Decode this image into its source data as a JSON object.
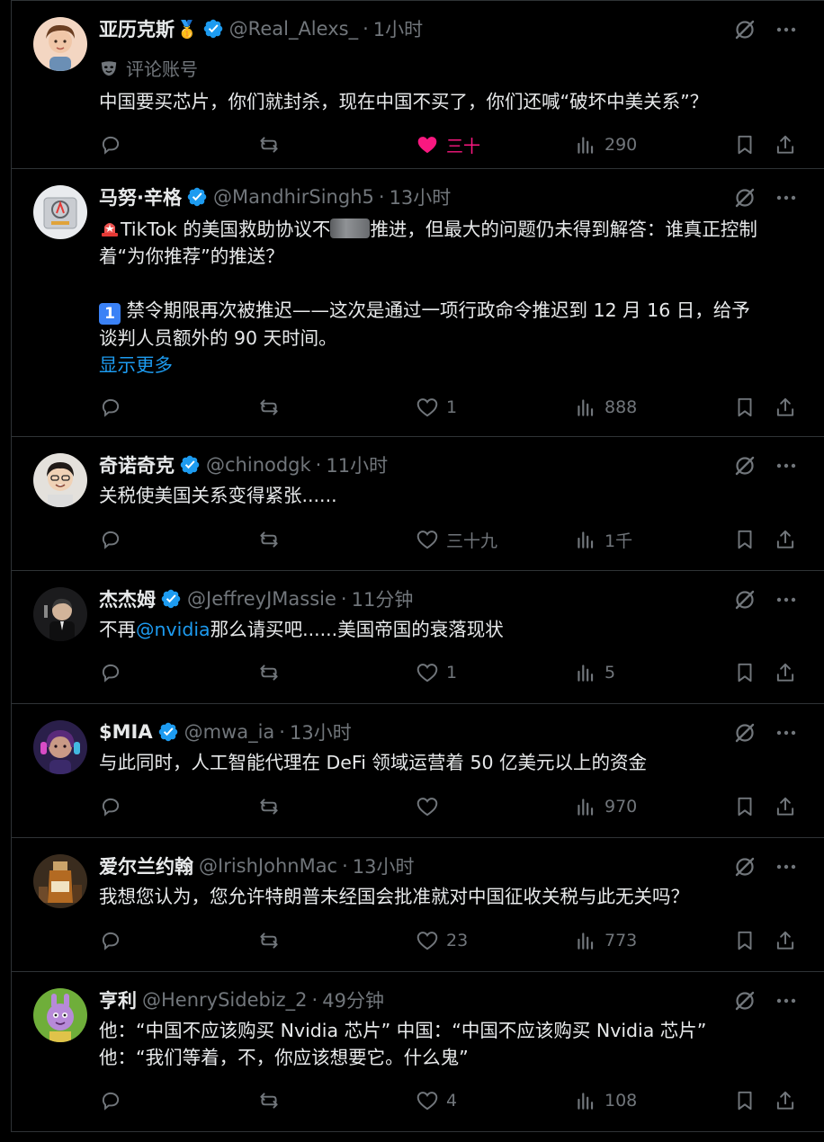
{
  "colors": {
    "background": "#000000",
    "text": "#e7e9ea",
    "muted": "#71767b",
    "link": "#1d9bf0",
    "liked": "#f91880",
    "verified": "#1d9bf0",
    "divider": "#2f3336"
  },
  "posts": [
    {
      "name": "亚历克斯",
      "name_badge": "🥇",
      "handle": "@Real_Alexs_",
      "time": "1小时",
      "sub_label": "评论账号",
      "sub_icon": "mask-icon",
      "text_lines": [
        "中国要买芯片，你们就封杀，现在中国不买了，你们还喊“破坏中美关系”？"
      ],
      "reply_count": "",
      "repost_count": "",
      "like_count": "三十",
      "liked": true,
      "view_count": "290"
    },
    {
      "name": "马努·辛格",
      "handle": "@MandhirSingh5",
      "time": "13小时",
      "text_line1_a": "TikTok 的美国救助协议不",
      "text_line1_b": "推进，但最大的问题仍未得到解答：谁真正控制",
      "text_line2": "着“为你推荐”的推送？",
      "keycap": "1",
      "text_line3": "禁令期限再次被推迟——这次是通过一项行政命令推迟到 12 月 16 日，给予",
      "text_line4": "谈判人员额外的 90 天时间。",
      "show_more": "显示更多",
      "like_count": "1",
      "view_count": "888"
    },
    {
      "name": "奇诺奇克",
      "handle": "@chinodgk",
      "time": "11小时",
      "text_lines": [
        "关税使美国关系变得紧张......"
      ],
      "like_count": "三十九",
      "view_count": "1千"
    },
    {
      "name": "杰杰姆",
      "handle": "@JeffreyJMassie",
      "time": "11分钟",
      "text_prefix": "不再",
      "text_mention": "@nvidia",
      "text_suffix": "那么请买吧......美国帝国的衰落现状",
      "like_count": "1",
      "view_count": "5"
    },
    {
      "name": "$MIA",
      "handle": "@mwa_ia",
      "time": "13小时",
      "text_lines": [
        "与此同时，人工智能代理在 DeFi 领域运营着 50 亿美元以上的资金"
      ],
      "like_count": "",
      "view_count": "970"
    },
    {
      "name": "爱尔兰约翰",
      "handle": "@IrishJohnMac",
      "time": "13小时",
      "text_lines": [
        "我想您认为，您允许特朗普未经国会批准就对中国征收关税与此无关吗？"
      ],
      "like_count": "23",
      "view_count": "773"
    },
    {
      "name": "亨利",
      "handle": "@HenrySidebiz_2",
      "time": "49分钟",
      "text_lines": [
        "他：“中国不应该购买 Nvidia 芯片” 中国：“中国不应该购买 Nvidia 芯片”",
        "他：“我们等着，不，你应该想要它。什么鬼”"
      ],
      "like_count": "4",
      "view_count": "108"
    }
  ]
}
